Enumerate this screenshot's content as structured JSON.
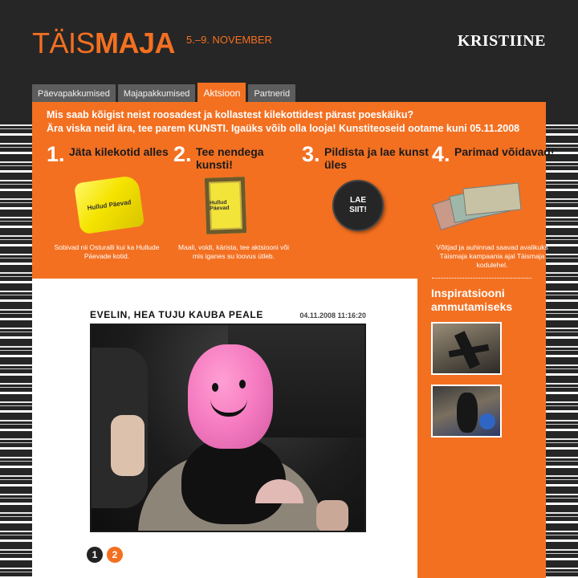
{
  "header": {
    "logo_light": "TÄIS",
    "logo_bold": "MAJA",
    "date": "5.–9. NOVEMBER",
    "brand": "KRISTIINE"
  },
  "tabs": [
    {
      "label": "Päevapakkumised"
    },
    {
      "label": "Majapakkumised"
    },
    {
      "label": "Aktsioon"
    },
    {
      "label": "Partnerid"
    }
  ],
  "intro": {
    "line1": "Mis saab kõigist neist roosadest ja kollastest kilekottidest pärast poeskäiku?",
    "line2": "Ära viska neid ära, tee parem KUNSTI. Igaüks võib olla looja! Kunstiteoseid ootame kuni 05.11.2008"
  },
  "steps": [
    {
      "num": "1.",
      "title": "Jäta kilekotid alles",
      "desc": "Sobivad nii Osturalli kui ka Hullude Päevade kotid.",
      "art_text": "Hullud Päevad"
    },
    {
      "num": "2.",
      "title": "Tee nendega kunsti!",
      "desc": "Maali, voldi, kärista, tee aktsiooni või mis iganes su loovus ütleb.",
      "art_text": "Hullud Päevad"
    },
    {
      "num": "3.",
      "title": "Pildista ja lae kunst üles",
      "desc": "",
      "button_line1": "LAE",
      "button_line2": "SIIT!"
    },
    {
      "num": "4.",
      "title": "Parimad võidavad!",
      "desc": "Võitjad ja auhinnad saavad avalikuks Täismaja kampaania ajal Täismaja kodulehel."
    }
  ],
  "post": {
    "title": "EVELIN, HEA TUJU KAUBA PEALE",
    "date": "04.11.2008 11:16:20"
  },
  "pager": [
    "1",
    "2"
  ],
  "sidebar": {
    "title": "Inspiratsiooni ammutamiseks"
  },
  "colors": {
    "accent": "#f37021",
    "background": "#262626"
  }
}
